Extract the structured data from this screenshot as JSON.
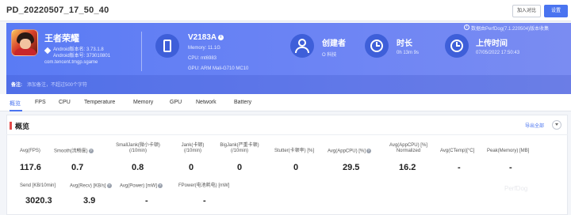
{
  "header": {
    "title": "PD_20220507_17_50_40",
    "compare_button": "加入对比",
    "settings_button": "设置"
  },
  "app": {
    "name": "王者荣耀",
    "version_line1": "Android版本名: 3.73.1.8",
    "version_line2": "Android版本号: 373010801",
    "package": "com.tencent.tmgp.sgame",
    "icon": "game-app-icon"
  },
  "device": {
    "model": "V2183A",
    "memory": "Memory: 11.1G",
    "cpu": "CPU: mt6983",
    "gpu": "GPU: ARM Mali-G710 MC10",
    "icon": "phone-icon"
  },
  "creator": {
    "label": "创建者",
    "value": "O 科技",
    "icon": "user-icon"
  },
  "duration": {
    "label": "时长",
    "value": "0h 13m 9s",
    "icon": "clock-icon"
  },
  "upload": {
    "label": "上传时间",
    "value": "07/05/2022 17:50:43",
    "icon": "history-icon"
  },
  "banner_note": "数据由PerfDog(7.1.220504)版本收集",
  "remark": {
    "label": "备注:",
    "text": "添加备注，不超过500个字符"
  },
  "tabs": [
    {
      "label": "概览"
    },
    {
      "label": "FPS"
    },
    {
      "label": "CPU"
    },
    {
      "label": "Temperature"
    },
    {
      "label": "Memory"
    },
    {
      "label": "GPU"
    },
    {
      "label": "Network"
    },
    {
      "label": "Battery"
    }
  ],
  "overview": {
    "title": "概览",
    "export": "导出全部",
    "row1": [
      {
        "label": "Avg(FPS)",
        "value": "117.6"
      },
      {
        "label": "Smooth(流畅度)",
        "value": "0.7"
      },
      {
        "label": "SmallJank(微小卡顿)\n(/10min)",
        "value": "0.8"
      },
      {
        "label": "Jank(卡顿)\n(/10min)",
        "value": "0"
      },
      {
        "label": "BigJank(严重卡顿)\n(/10min)",
        "value": "0"
      },
      {
        "label": "Stutter(卡顿率) [%]",
        "value": "0"
      },
      {
        "label": "Avg(AppCPU) [%]",
        "value": "29.5"
      },
      {
        "label": "Avg(AppCPU) [%]\nNormalized",
        "value": "16.2"
      },
      {
        "label": "Avg(CTemp)[°C]",
        "value": "-"
      },
      {
        "label": "Peak(Memory) [MB]",
        "value": "-"
      }
    ],
    "row2": [
      {
        "label": "Send [KB/10min]",
        "value": "3020.3"
      },
      {
        "label": "Avg(Recv) [KB/s]",
        "value": "3.9"
      },
      {
        "label": "Avg(Power) [mW]",
        "value": "-"
      },
      {
        "label": "FPower(电池耗电) [mW]",
        "value": "-"
      }
    ]
  },
  "colors": {
    "accent": "#4a74f0",
    "banner": "#5a7bf4",
    "section_marker": "#e24b4b"
  }
}
